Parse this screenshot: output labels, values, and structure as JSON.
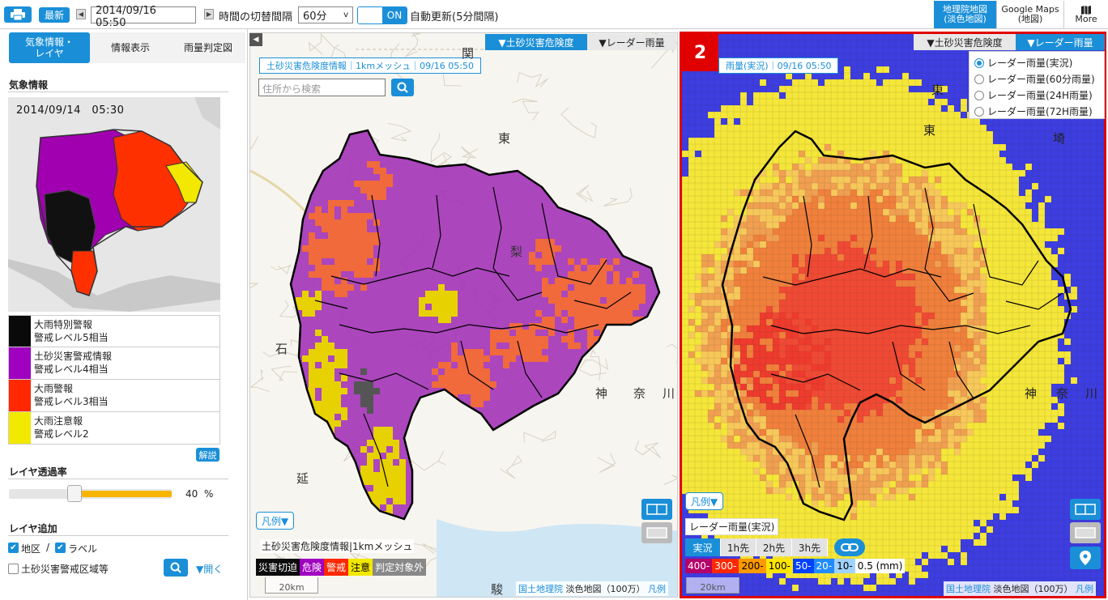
{
  "toolbar": {
    "latest_label": "最新",
    "datetime": "2014/09/16　05:50",
    "interval_label": "時間の切替間隔",
    "interval_value": "60分",
    "toggle_on": "ON",
    "auto_update": "自動更新(5分間隔)",
    "basemap_label": "地理院地図\n(淡色地図)",
    "google_label": "Google Maps\n(地図)",
    "more_label": "More"
  },
  "left": {
    "tabs": [
      {
        "label": "気象情報・\nレイヤ"
      },
      {
        "label": "情報表示"
      },
      {
        "label": "雨量判定図"
      }
    ],
    "weather_title": "気象情報",
    "thumb_time": "2014/09/14　05:30",
    "legend": [
      {
        "label": "大雨特別警報\n警戒レベル5相当",
        "color": "#0a0a0a"
      },
      {
        "label": "土砂災害警戒情報\n警戒レベル4相当",
        "color": "#a000c0"
      },
      {
        "label": "大雨警報\n警戒レベル3相当",
        "color": "#ff2800"
      },
      {
        "label": "大雨注意報\n警戒レベル2",
        "color": "#f2e800"
      }
    ],
    "explain_label": "解説",
    "opacity_title": "レイヤ透過率",
    "opacity_value": "40",
    "opacity_unit": "%",
    "opacity_fraction": 0.4,
    "layer_title": "レイヤ追加",
    "check_district": "地区",
    "separator": "/",
    "check_label": "ラベル",
    "check_area": "土砂災害警戒区域等",
    "open_label": "▼開く"
  },
  "map1": {
    "tab_active": "▼土砂災害危険度",
    "tab_inactive": "▼レーダー雨量",
    "info_label": "土砂災害危険度情報｜1kmメッシュ｜09/16 05:50",
    "search_placeholder": "住所から検索",
    "legend_btn": "凡例▼",
    "legend_title": "土砂災害危険度情報|1kmメッシュ",
    "cats": [
      {
        "label": "災害切迫",
        "color": "#0c0c0c"
      },
      {
        "label": "危険",
        "color": "#a000c0"
      },
      {
        "label": "警戒",
        "color": "#ff2800"
      },
      {
        "label": "注意",
        "color": "#f2e800",
        "text": "#000"
      },
      {
        "label": "判定対象外",
        "color": "#888888"
      }
    ],
    "scale": "20km",
    "attribution_link": "国土地理院",
    "attribution_text": "淡色地図（100万）",
    "legend_link": "凡例",
    "place_labels": [
      "関",
      "東",
      "梨",
      "神",
      "奈",
      "川",
      "駿",
      "石",
      "延"
    ]
  },
  "map2": {
    "badge": "2",
    "tab_inactive": "▼土砂災害危険度",
    "tab_active": "▼レーダー雨量",
    "info_label": "雨量(実況)｜09/16 05:50",
    "radios": [
      {
        "label": "レーダー雨量(実況)",
        "checked": true
      },
      {
        "label": "レーダー雨量(60分雨量)",
        "checked": false
      },
      {
        "label": "レーダー雨量(24H雨量)",
        "checked": false
      },
      {
        "label": "レーダー雨量(72H雨量)",
        "checked": false
      }
    ],
    "legend_btn": "凡例▼",
    "legend_title": "レーダー雨量(実況)",
    "time_tabs": [
      "実況",
      "1h先",
      "2h先",
      "3h先"
    ],
    "scale_items": [
      {
        "label": "400-",
        "color": "#b4006a",
        "text": "#fff"
      },
      {
        "label": "300-",
        "color": "#ff2800",
        "text": "#fff"
      },
      {
        "label": "200-",
        "color": "#ff9900",
        "text": "#000"
      },
      {
        "label": "100-",
        "color": "#ffe600",
        "text": "#000"
      },
      {
        "label": "50-",
        "color": "#0041ff",
        "text": "#fff"
      },
      {
        "label": "20-",
        "color": "#218cff",
        "text": "#fff"
      },
      {
        "label": "10-",
        "color": "#a0d2ff",
        "text": "#000"
      },
      {
        "label": "0.5 (mm)",
        "color": "#ffffff",
        "text": "#000"
      }
    ],
    "scale": "20km",
    "attribution_link": "国土地理院",
    "attribution_text": "淡色地図（100万）",
    "legend_link": "凡例",
    "place_labels": [
      "東",
      "東",
      "埼",
      "神",
      "奈",
      "川"
    ]
  }
}
